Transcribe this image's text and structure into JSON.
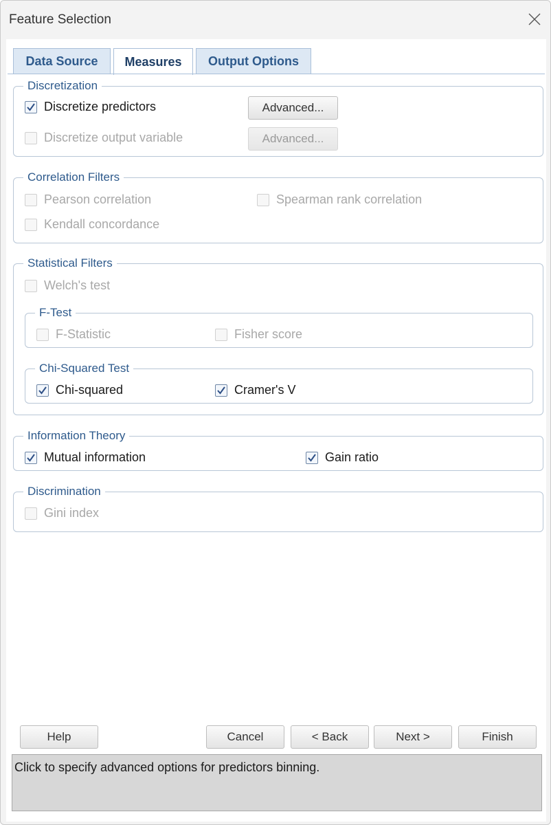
{
  "window": {
    "title": "Feature Selection"
  },
  "tabs": [
    {
      "label": "Data Source"
    },
    {
      "label": "Measures"
    },
    {
      "label": "Output Options"
    }
  ],
  "discretization": {
    "title": "Discretization",
    "discretize_predictors": {
      "label": "Discretize predictors",
      "checked": true,
      "enabled": true
    },
    "discretize_predictors_advanced": "Advanced...",
    "discretize_output": {
      "label": "Discretize output variable",
      "checked": false,
      "enabled": false
    },
    "discretize_output_advanced": "Advanced..."
  },
  "correlation": {
    "title": "Correlation Filters",
    "pearson": {
      "label": "Pearson correlation",
      "checked": false,
      "enabled": false
    },
    "spearman": {
      "label": "Spearman rank correlation",
      "checked": false,
      "enabled": false
    },
    "kendall": {
      "label": "Kendall concordance",
      "checked": false,
      "enabled": false
    }
  },
  "statistical": {
    "title": "Statistical Filters",
    "welch": {
      "label": "Welch's test",
      "checked": false,
      "enabled": false
    },
    "ftest": {
      "title": "F-Test",
      "fstat": {
        "label": "F-Statistic",
        "checked": false,
        "enabled": false
      },
      "fisher": {
        "label": "Fisher score",
        "checked": false,
        "enabled": false
      }
    },
    "chisq": {
      "title": "Chi-Squared Test",
      "chisquared": {
        "label": "Chi-squared",
        "checked": true,
        "enabled": true
      },
      "cramer": {
        "label": "Cramer's V",
        "checked": true,
        "enabled": true
      }
    }
  },
  "information": {
    "title": "Information Theory",
    "mutual": {
      "label": "Mutual information",
      "checked": true,
      "enabled": true
    },
    "gain": {
      "label": "Gain ratio",
      "checked": true,
      "enabled": true
    }
  },
  "discrimination": {
    "title": "Discrimination",
    "gini": {
      "label": "Gini index",
      "checked": false,
      "enabled": false
    }
  },
  "buttons": {
    "help": "Help",
    "cancel": "Cancel",
    "back": "< Back",
    "next": "Next >",
    "finish": "Finish"
  },
  "status_text": "Click to specify advanced options for predictors binning.",
  "colors": {
    "accent": "#2e5a8c",
    "tab_bg": "#dde8f4",
    "status_bg": "#d7d7d7"
  }
}
